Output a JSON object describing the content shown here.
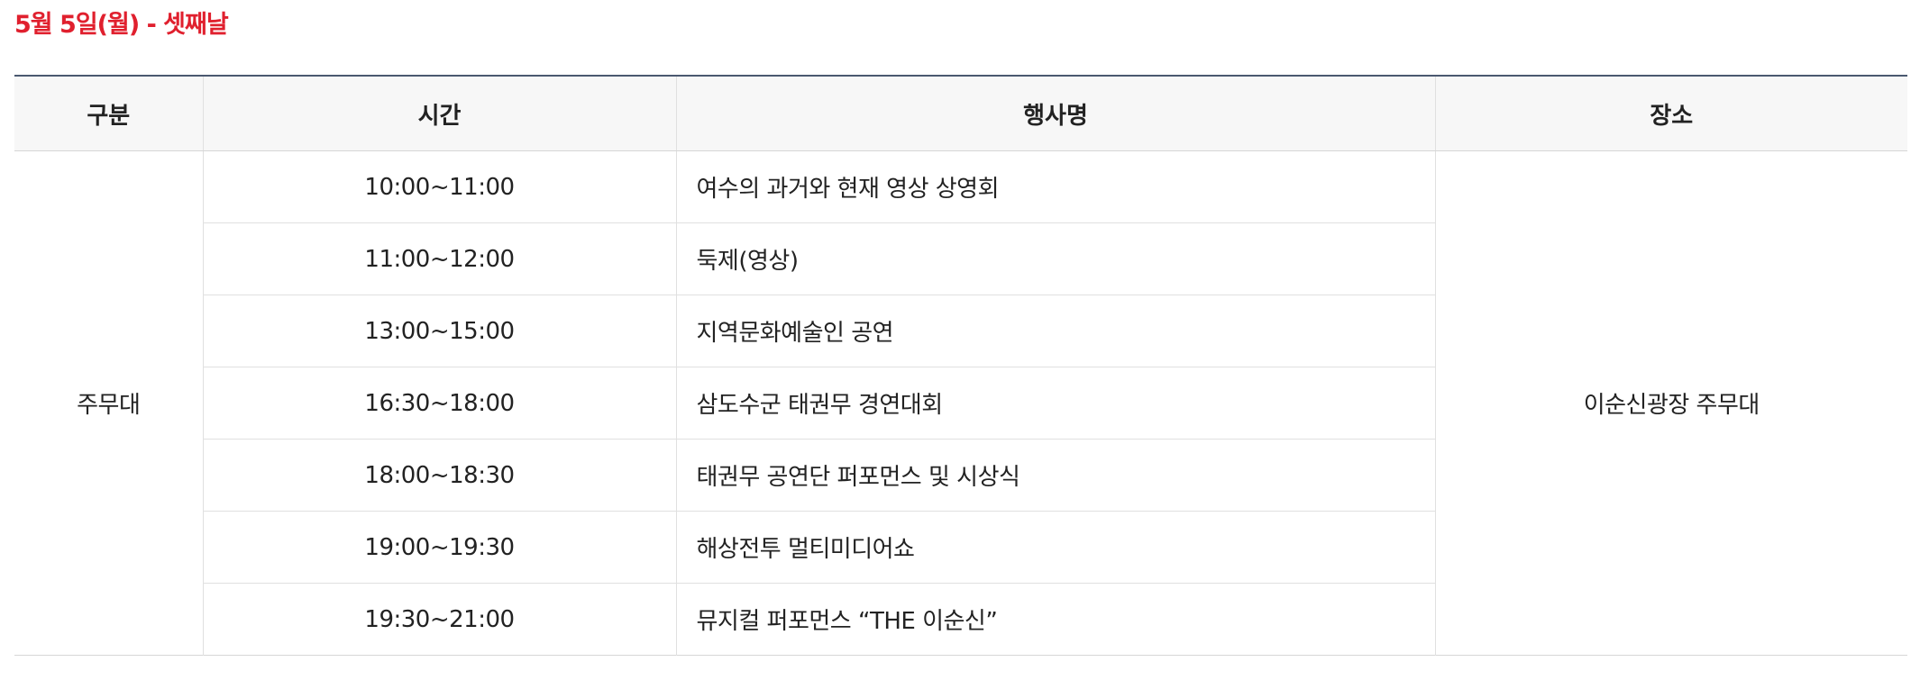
{
  "day_title": "5월 5일(월) - 셋째날",
  "table": {
    "headers": {
      "category": "구분",
      "time": "시간",
      "event": "행사명",
      "venue": "장소"
    },
    "category": "주무대",
    "venue": "이순신광장 주무대",
    "rows": [
      {
        "time": "10:00~11:00",
        "event": "여수의 과거와 현재 영상 상영회"
      },
      {
        "time": "11:00~12:00",
        "event": "둑제(영상)"
      },
      {
        "time": "13:00~15:00",
        "event": "지역문화예술인 공연"
      },
      {
        "time": "16:30~18:00",
        "event": "삼도수군 태권무 경연대회"
      },
      {
        "time": "18:00~18:30",
        "event": "태권무 공연단 퍼포먼스 및 시상식"
      },
      {
        "time": "19:00~19:30",
        "event": "해상전투 멀티미디어쇼"
      },
      {
        "time": "19:30~21:00",
        "event": "뮤지컬 퍼포먼스 “THE 이순신”"
      }
    ]
  }
}
